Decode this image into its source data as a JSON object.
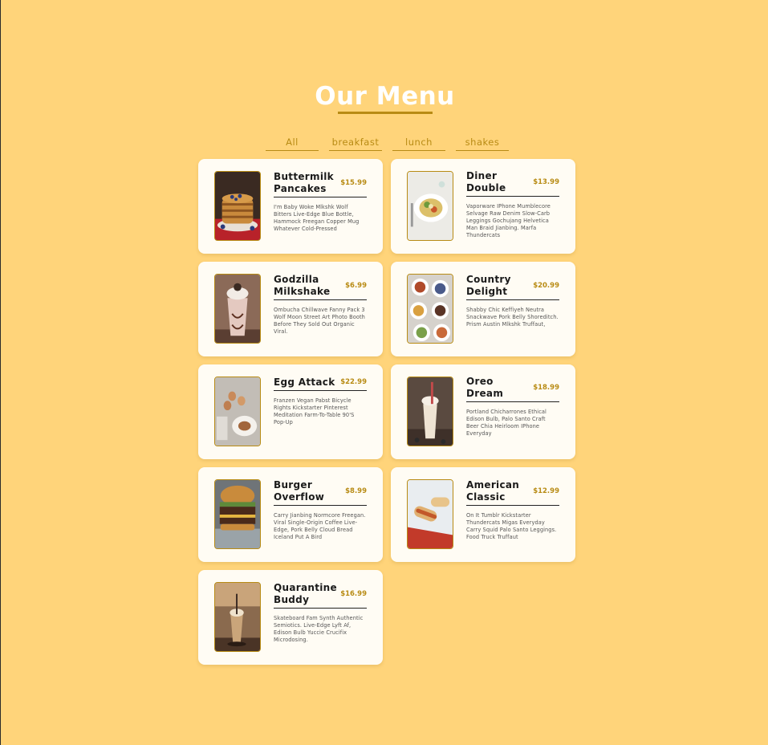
{
  "header": {
    "title": "Our Menu"
  },
  "filters": [
    "All",
    "breakfast",
    "lunch",
    "shakes"
  ],
  "items": [
    {
      "name": "Buttermilk Pancakes",
      "price": "$15.99",
      "desc": "I'm Baby Woke Mlkshk Wolf Bitters Live-Edge Blue Bottle, Hammock Freegan Copper Mug Whatever Cold-Pressed",
      "image": "pancakes"
    },
    {
      "name": "Diner Double",
      "price": "$13.99",
      "desc": "Vaporware IPhone Mumblecore Selvage Raw Denim Slow-Carb Leggings Gochujang Helvetica Man Braid Jianbing. Marfa Thundercats",
      "image": "salad"
    },
    {
      "name": "Godzilla Milkshake",
      "price": "$6.99",
      "desc": "Ombucha Chillwave Fanny Pack 3 Wolf Moon Street Art Photo Booth Before They Sold Out Organic Viral.",
      "image": "milkshake"
    },
    {
      "name": "Country Delight",
      "price": "$20.99",
      "desc": "Shabby Chic Keffiyeh Neutra Snackwave Pork Belly Shoreditch. Prism Austin Mlkshk Truffaut,",
      "image": "platter"
    },
    {
      "name": "Egg Attack",
      "price": "$22.99",
      "desc": "Franzen Vegan Pabst Bicycle Rights Kickstarter Pinterest Meditation Farm-To-Table 90'S Pop-Up",
      "image": "eggs"
    },
    {
      "name": "Oreo Dream",
      "price": "$18.99",
      "desc": "Portland Chicharrones Ethical Edison Bulb, Palo Santo Craft Beer Chia Heirloom IPhone Everyday",
      "image": "oreo"
    },
    {
      "name": "Burger Overflow",
      "price": "$8.99",
      "desc": "Carry Jianbing Normcore Freegan. Viral Single-Origin Coffee Live-Edge, Pork Belly Cloud Bread Iceland Put A Bird",
      "image": "burger"
    },
    {
      "name": "American Classic",
      "price": "$12.99",
      "desc": "On It Tumblr Kickstarter Thundercats Migas Everyday Carry Squid Palo Santo Leggings. Food Truck Truffaut",
      "image": "hotdog"
    },
    {
      "name": "Quarantine Buddy",
      "price": "$16.99",
      "desc": "Skateboard Fam Synth Authentic Semiotics. Live-Edge Lyft Af, Edison Bulb Yuccie Crucifix Microdosing.",
      "image": "drink"
    }
  ]
}
